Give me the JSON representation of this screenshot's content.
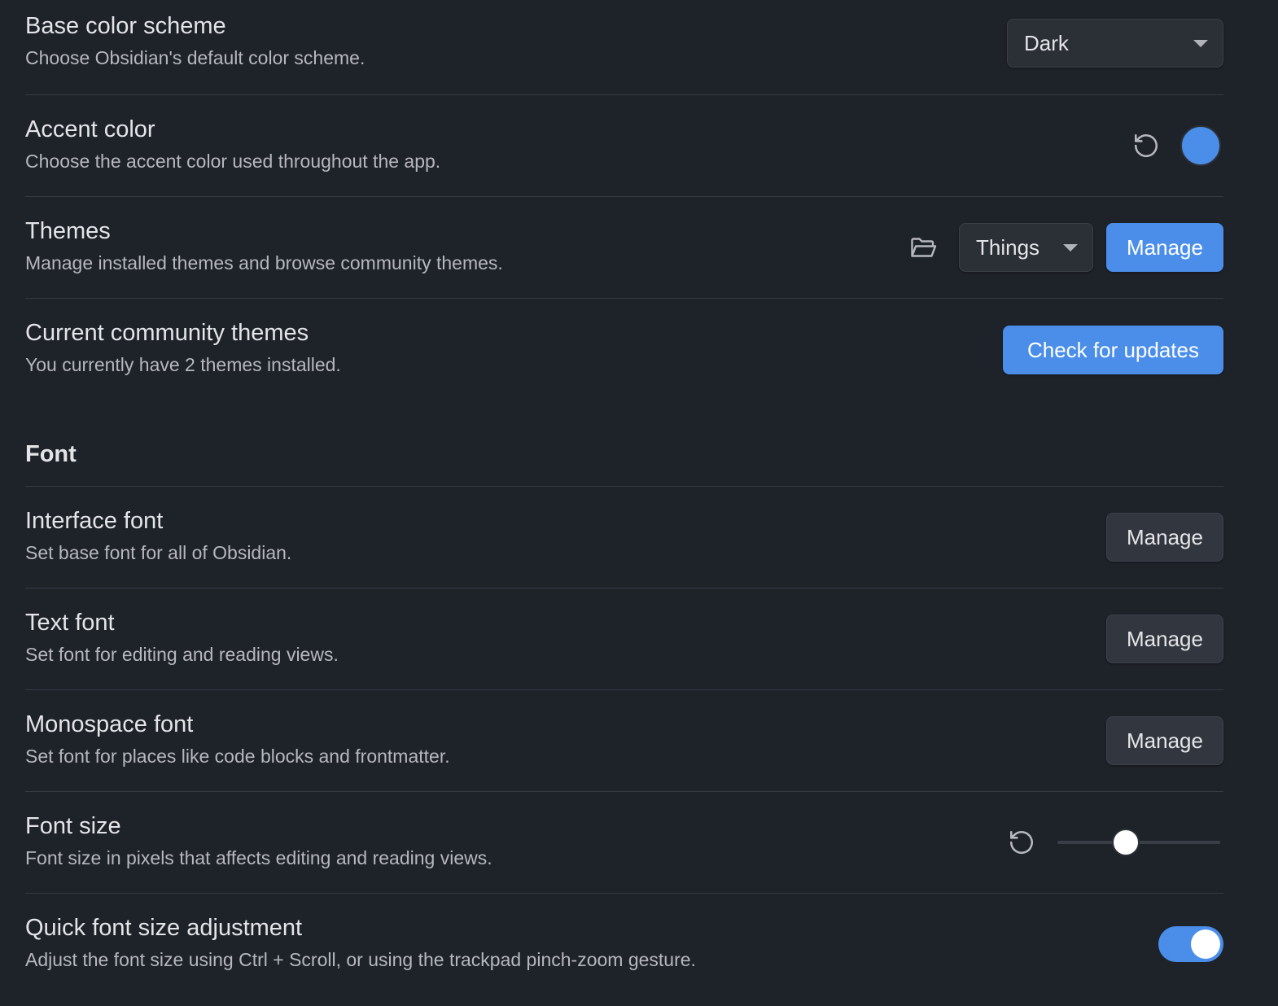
{
  "colors": {
    "accent": "#4a8eea",
    "background": "#1e2229"
  },
  "appearance": {
    "base_color_scheme": {
      "name": "Base color scheme",
      "desc": "Choose Obsidian's default color scheme.",
      "selected": "Dark"
    },
    "accent_color": {
      "name": "Accent color",
      "desc": "Choose the accent color used throughout the app.",
      "reset_icon": "reset-icon",
      "swatch_color": "#4a8eea"
    },
    "themes": {
      "name": "Themes",
      "desc": "Manage installed themes and browse community themes.",
      "folder_icon": "folder-open-icon",
      "selected": "Things",
      "manage_label": "Manage"
    },
    "community_themes": {
      "name": "Current community themes",
      "desc": "You currently have 2 themes installed.",
      "check_label": "Check for updates"
    }
  },
  "font": {
    "heading": "Font",
    "interface_font": {
      "name": "Interface font",
      "desc": "Set base font for all of Obsidian.",
      "manage_label": "Manage"
    },
    "text_font": {
      "name": "Text font",
      "desc": "Set font for editing and reading views.",
      "manage_label": "Manage"
    },
    "monospace_font": {
      "name": "Monospace font",
      "desc": "Set font for places like code blocks and frontmatter.",
      "manage_label": "Manage"
    },
    "font_size": {
      "name": "Font size",
      "desc": "Font size in pixels that affects editing and reading views.",
      "reset_icon": "reset-icon",
      "slider_fraction": 0.42
    },
    "quick_adjust": {
      "name": "Quick font size adjustment",
      "desc": "Adjust the font size using Ctrl + Scroll, or using the trackpad pinch-zoom gesture.",
      "enabled": true
    }
  }
}
